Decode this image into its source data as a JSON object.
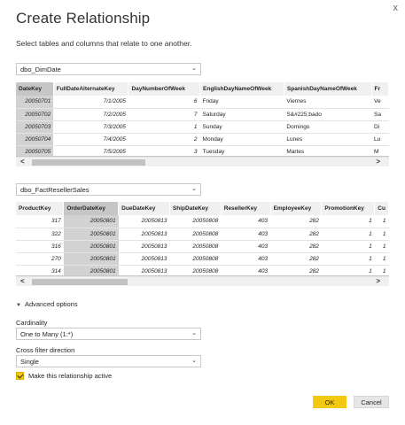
{
  "dialog": {
    "title": "Create Relationship",
    "subtitle": "Select tables and columns that relate to one another.",
    "close_glyph": "x"
  },
  "table1": {
    "select_value": "dbo_DimDate",
    "columns": [
      "DateKey",
      "FullDateAlternateKey",
      "DayNumberOfWeek",
      "EnglishDayNameOfWeek",
      "SpanishDayNameOfWeek",
      "Fr"
    ],
    "selected_column": 0,
    "rows": [
      [
        "20050701",
        "7/1/2005",
        "6",
        "Friday",
        "Viernes",
        "Ve"
      ],
      [
        "20050702",
        "7/2/2005",
        "7",
        "Saturday",
        "S&#225;bado",
        "Sa"
      ],
      [
        "20050703",
        "7/3/2005",
        "1",
        "Sunday",
        "Domingo",
        "Di"
      ],
      [
        "20050704",
        "7/4/2005",
        "2",
        "Monday",
        "Lunes",
        "Lu"
      ],
      [
        "20050705",
        "7/5/2005",
        "3",
        "Tuesday",
        "Martes",
        "M"
      ]
    ]
  },
  "table2": {
    "select_value": "dbo_FactResellerSales",
    "columns": [
      "ProductKey",
      "OrderDateKey",
      "DueDateKey",
      "ShipDateKey",
      "ResellerKey",
      "EmployeeKey",
      "PromotionKey",
      "Cu"
    ],
    "selected_column": 1,
    "rows": [
      [
        "317",
        "20050801",
        "20050813",
        "20050808",
        "403",
        "282",
        "1",
        "1"
      ],
      [
        "322",
        "20050801",
        "20050813",
        "20050808",
        "403",
        "282",
        "1",
        "1"
      ],
      [
        "316",
        "20050801",
        "20050813",
        "20050808",
        "403",
        "282",
        "1",
        "1"
      ],
      [
        "270",
        "20050801",
        "20050813",
        "20050808",
        "403",
        "282",
        "1",
        "1"
      ],
      [
        "314",
        "20050801",
        "20050813",
        "20050808",
        "403",
        "282",
        "1",
        "1"
      ]
    ]
  },
  "scroll": {
    "left_arrow": "<",
    "right_arrow": ">"
  },
  "advanced": {
    "toggle_label": "Advanced options",
    "cardinality_label": "Cardinality",
    "cardinality_value": "One to Many (1:*)",
    "cross_filter_label": "Cross filter direction",
    "cross_filter_value": "Single",
    "active_label": "Make this relationship active",
    "active_checked": true
  },
  "buttons": {
    "ok": "OK",
    "cancel": "Cancel"
  },
  "colors": {
    "accent": "#f2c811",
    "selected_column": "#d2d2d2",
    "header_bg": "#f0f0f0"
  }
}
